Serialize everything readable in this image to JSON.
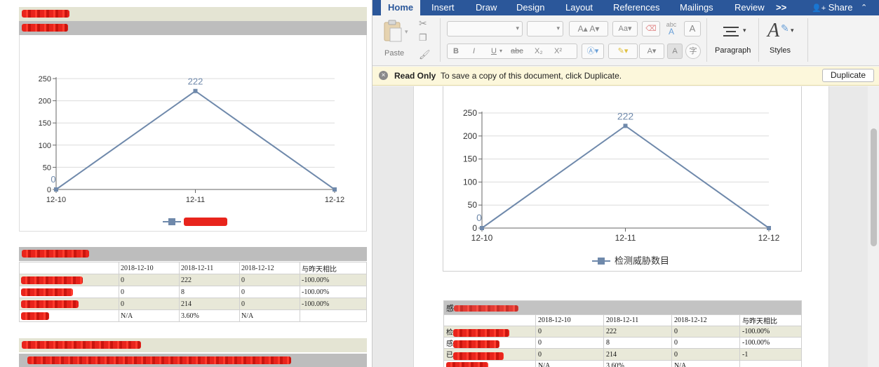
{
  "left": {
    "table": {
      "headers": [
        "",
        "2018-12-10",
        "2018-12-11",
        "2018-12-12",
        "与昨天相比"
      ],
      "rows": [
        [
          "",
          "0",
          "222",
          "0",
          "-100.00%"
        ],
        [
          "",
          "0",
          "8",
          "0",
          "-100.00%"
        ],
        [
          "",
          "0",
          "214",
          "0",
          "-100.00%"
        ],
        [
          "",
          "N/A",
          "3.60%",
          "N/A",
          ""
        ]
      ]
    }
  },
  "chart_data": [
    {
      "type": "line",
      "categories": [
        "12-10",
        "12-11",
        "12-12"
      ],
      "series": [
        {
          "name": "",
          "values": [
            0,
            222,
            0
          ]
        }
      ],
      "data_labels": [
        "0",
        "222",
        ""
      ],
      "yticks": [
        "250",
        "200",
        "150",
        "100",
        "50",
        "0"
      ],
      "ylim": [
        0,
        250
      ],
      "grid": true,
      "legend_placement": "bottom",
      "color": "#6f89ab"
    },
    {
      "type": "line",
      "categories": [
        "12-10",
        "12-11",
        "12-12"
      ],
      "series": [
        {
          "name": "检测威胁数目",
          "values": [
            0,
            222,
            0
          ]
        }
      ],
      "data_labels": [
        "0",
        "222",
        ""
      ],
      "yticks": [
        "250",
        "200",
        "150",
        "100",
        "50",
        "0"
      ],
      "ylim": [
        0,
        250
      ],
      "grid": true,
      "legend_placement": "bottom",
      "color": "#6f89ab"
    }
  ],
  "word": {
    "tabs": [
      "Home",
      "Insert",
      "Draw",
      "Design",
      "Layout",
      "References",
      "Mailings",
      "Review",
      ">>"
    ],
    "share_label": "Share",
    "paste_label": "Paste",
    "paragraph_label": "Paragraph",
    "styles_label": "Styles",
    "format_buttons": [
      "B",
      "I",
      "U",
      "abc",
      "X₂",
      "X²"
    ],
    "infobar": {
      "title": "Read Only",
      "message": "To save a copy of this document, click Duplicate.",
      "button": "Duplicate"
    },
    "table": {
      "title": "感",
      "headers": [
        "",
        "2018-12-10",
        "2018-12-11",
        "2018-12-12",
        "与昨天相比"
      ],
      "rows": [
        [
          "检",
          "0",
          "222",
          "0",
          "-100.00%"
        ],
        [
          "感",
          "0",
          "8",
          "0",
          "-100.00%"
        ],
        [
          "已",
          "0",
          "214",
          "0",
          "-1"
        ],
        [
          "",
          "N/A",
          "3.60%",
          "N/A",
          ""
        ]
      ]
    },
    "colors": {
      "tabbar": "#2b579a",
      "infobar": "#fcf7db",
      "series": "#6f89ab"
    }
  }
}
